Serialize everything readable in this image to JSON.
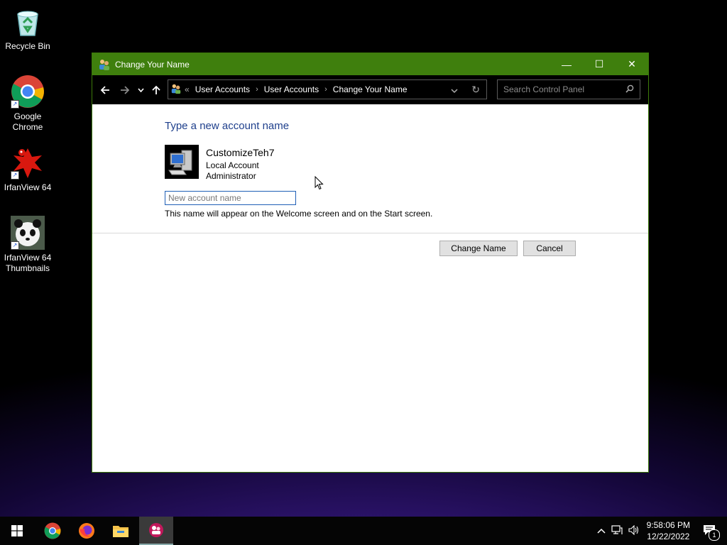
{
  "desktop": {
    "icons": [
      {
        "label": "Recycle Bin"
      },
      {
        "label": "Google Chrome"
      },
      {
        "label": "IrfanView 64"
      },
      {
        "label": "IrfanView 64 Thumbnails"
      }
    ]
  },
  "window": {
    "title": "Change Your Name",
    "breadcrumbs": [
      "User Accounts",
      "User Accounts",
      "Change Your Name"
    ],
    "breadcrumb_prefix": "«",
    "search_placeholder": "Search Control Panel",
    "accent": "#3f7f0d"
  },
  "content": {
    "heading": "Type a new account name",
    "account": {
      "name": "CustomizeTeh7",
      "type": "Local Account",
      "role": "Administrator"
    },
    "input_placeholder": "New account name",
    "input_value": "",
    "hint": "This name will appear on the Welcome screen and on the Start screen.",
    "buttons": {
      "change": "Change Name",
      "cancel": "Cancel"
    }
  },
  "taskbar": {
    "time": "9:58:06 PM",
    "date": "12/22/2022",
    "notifications": "1"
  }
}
